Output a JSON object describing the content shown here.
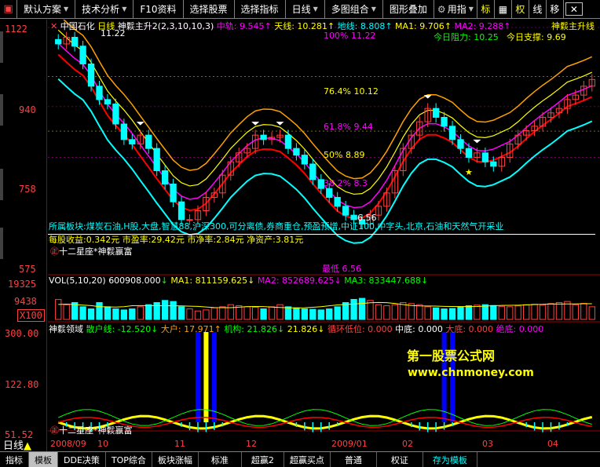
{
  "menu": {
    "items": [
      {
        "label": "默认方案",
        "arrow": true
      },
      {
        "label": "技术分析",
        "arrow": true
      },
      {
        "label": "F10资料",
        "arrow": false
      },
      {
        "label": "选择股票",
        "arrow": false
      },
      {
        "label": "选择指标",
        "arrow": false
      },
      {
        "label": "日线",
        "arrow": true
      },
      {
        "label": "多图组合",
        "arrow": true
      },
      {
        "label": "图形叠加",
        "arrow": false
      },
      {
        "label": "用指",
        "arrow": true
      }
    ],
    "tools": [
      "标",
      "权",
      "线",
      "移"
    ],
    "close_symbol": "✕"
  },
  "main": {
    "stock_name": "中国石化",
    "period": "日线",
    "indicator_name": "神鬏主升2(2,3,10,10,3)",
    "mid_label": "中轨: 9.545",
    "sky_label": "天线: 10.281",
    "ground_label": "地线: 8.808",
    "ma1_label": "MA1: 9.706",
    "ma2_label": "MA2: 9.288",
    "right_title": "神鬏主升线",
    "resistance_label": "今日阻力: 10.25",
    "support_label": "今日支撑: 9.69",
    "fib_100": "100%  11.22",
    "fib_764": "76.4%  10.12",
    "fib_618": "61.8%  9.44",
    "fib_50": "50%  8.89",
    "fib_382": "38.2%  8.3",
    "peak_label": "11.22",
    "low_label": "6.56",
    "zuidi_label": "最低  6.56",
    "sector_text": "所属板块:煤炭石油,H股,大盘,智慧88,沪深300,可分离债,券商重仓,预盈预增,中证100,中字头,北京,石油和天然气开采业",
    "finance_text": "每股收益:0.342元 市盈率:29.42元 市净率:2.84元 净资产:3.81元",
    "brand_text": "十二星座*神鬏嬴富",
    "scale": [
      "1122",
      "940",
      "758",
      "575"
    ]
  },
  "volume": {
    "label": "VOL(5,10,20)",
    "vol_value": "600908.000",
    "ma1": "MA1: 811159.625",
    "ma2": "MA2: 852689.625",
    "ma3": "MA3: 833447.688",
    "scale": [
      "19325",
      "9438",
      "X100"
    ]
  },
  "indicator": {
    "name": "神鬏领域",
    "retail": "散户线: -12.520",
    "big": "大户: 17.971",
    "inst": "机构: 21.826",
    "inst2": "21.826",
    "cycle_low": "循环低位: 0.000",
    "mid_bottom": "中底: 0.000",
    "big_bottom": "大底: 0.000",
    "abs_bottom": "绝底: 0.000",
    "scale": [
      "300.00",
      "122.80",
      "51.52"
    ],
    "watermark1": "第一股票公式网",
    "watermark2": "www.chnmoney.com",
    "brand_text": "十二星座*神鬏嬴富"
  },
  "dates": [
    "2008/09",
    "10",
    "11",
    "12",
    "2009/01",
    "02",
    "03",
    "04"
  ],
  "bottom_tabs": [
    "指标",
    "模板",
    "DDE决策",
    "TOP综合",
    "板块涨幅",
    "标准",
    "超赢2",
    "超赢买点",
    "普通",
    "权证",
    "存为模板"
  ],
  "corner_label": "日线",
  "colors": {
    "up": "#ff4040",
    "down": "#00ffff",
    "yellow": "#ffff00",
    "orange": "#ffa000",
    "red": "#ff0000",
    "magenta": "#ff00ff",
    "green": "#00ff00"
  },
  "chart_data": {
    "type": "candlestick",
    "ylim": [
      575,
      1122
    ],
    "close": [
      1085,
      1100,
      1080,
      1040,
      990,
      960,
      950,
      905,
      870,
      860,
      880,
      850,
      800,
      770,
      730,
      690,
      690,
      710,
      740,
      750,
      790,
      820,
      840,
      850,
      880,
      870,
      875,
      880,
      850,
      835,
      815,
      780,
      760,
      740,
      720,
      700,
      690,
      680,
      700,
      720,
      750,
      800,
      850,
      880,
      910,
      940,
      920,
      900,
      870,
      850,
      830,
      840,
      820,
      810,
      830,
      860,
      880,
      890,
      900,
      920,
      930,
      940,
      960,
      970,
      990,
      1005
    ],
    "volume": [
      9438,
      7000,
      8000,
      6000,
      5000,
      8000,
      6000,
      5000,
      4500,
      5000,
      6000,
      7000,
      8000,
      9000,
      8500,
      6000,
      5000,
      4000,
      4500,
      5500,
      6000,
      7000,
      6500,
      6000,
      5800,
      5000,
      6000,
      7000,
      6000,
      5500,
      5000,
      4800,
      4500,
      5000,
      6000,
      8000,
      9500,
      10000,
      9000,
      7000,
      6500,
      7000,
      8000,
      7500,
      7000,
      6000,
      5500,
      5000,
      5200,
      6000,
      6500,
      6800,
      7000,
      6600,
      6200,
      6000,
      6400,
      7000,
      7200,
      6800,
      7500,
      8000,
      8500,
      7000,
      7600,
      6009
    ]
  }
}
